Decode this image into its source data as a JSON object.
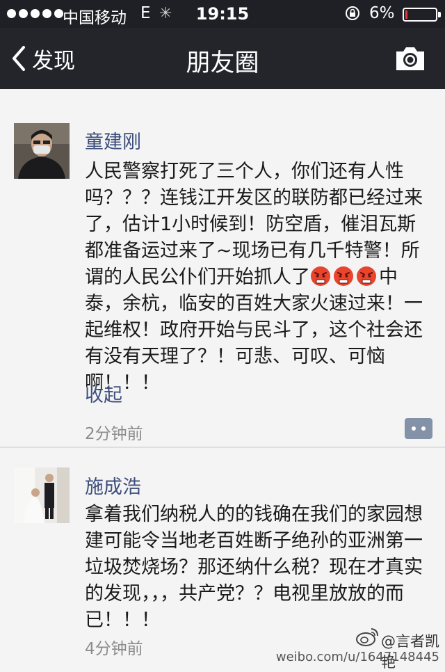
{
  "status_bar": {
    "carrier": "中国移动",
    "network": "E",
    "time": "19:15",
    "battery_percent_label": "6%",
    "battery_level": 0.06,
    "battery_color": "#e53935"
  },
  "nav": {
    "back_label": "发现",
    "title": "朋友圈",
    "back_icon": "chevron-left-icon",
    "camera_icon": "camera-icon"
  },
  "posts": [
    {
      "author": "童建刚",
      "content_before_emoji": "人民警察打死了三个人，你们还有人性吗？？？连钱江开发区的联防都已经过来了，估计1小时候到！防空盾，催泪瓦斯都准备运过来了~现场已有几千特警！所谓的人民公仆们开始抓人了",
      "emoji_count": 3,
      "emoji_icon": "angry-face-icon",
      "content_after_emoji": "中泰，余杭，临安的百姓大家火速过来！一起维权！政府开始与民斗了，这个社会还有没有天理了？！可悲、可叹、可恼啊！！！",
      "collapse_label": "收起",
      "time": "2分钟前",
      "comment_icon": "comment-icon"
    },
    {
      "author": "施成浩",
      "content": "拿着我们纳税人的的钱确在我们的家园想建可能令当地老百姓断子绝孙的亚洲第一垃圾焚烧场？那还纳什么税？现在才真实的发现，，，共产党？？电视里放放的而已！！！",
      "time": "4分钟前"
    }
  ],
  "watermark": {
    "handle": "@言者凯艳",
    "url": "weibo.com/u/1647148445",
    "logo_icon": "weibo-logo-icon"
  },
  "colors": {
    "bar_background": "#23252b",
    "author_name": "#3e4f7d",
    "timestamp": "#8c8c8c",
    "comment_button": "#8392a6"
  }
}
